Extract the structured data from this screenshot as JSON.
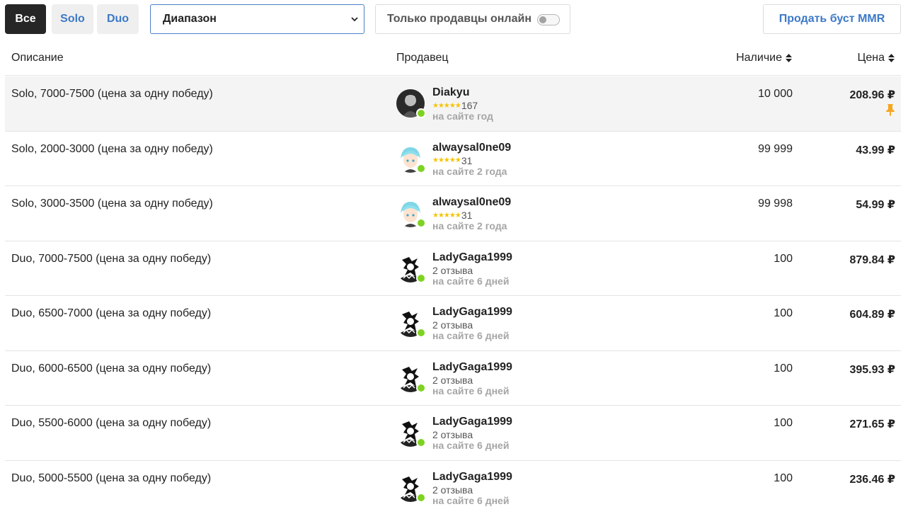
{
  "filters": {
    "all_label": "Все",
    "solo_label": "Solo",
    "duo_label": "Duo",
    "range_selected": "Диапазон",
    "online_only_label": "Только продавцы онлайн",
    "online_only_enabled": false,
    "sell_button_label": "Продать буст MMR"
  },
  "table": {
    "headers": {
      "description": "Описание",
      "seller": "Продавец",
      "stock": "Наличие",
      "price": "Цена"
    },
    "rows": [
      {
        "description": "Solo, 7000-7500 (цена за одну победу)",
        "seller": "Diakyu",
        "stars": "★★★★★",
        "rating": "167",
        "since": "на сайте год",
        "stock": "10 000",
        "price": "208.96 ₽",
        "pinned": true,
        "avatar": "dark-avatar"
      },
      {
        "description": "Solo, 2000-3000 (цена за одну победу)",
        "seller": "alwaysal0ne09",
        "stars": "★★★★★",
        "rating": "31",
        "since": "на сайте 2 года",
        "stock": "99 999",
        "price": "43.99 ₽",
        "pinned": false,
        "avatar": "anime-blue-hair-avatar"
      },
      {
        "description": "Solo, 3000-3500 (цена за одну победу)",
        "seller": "alwaysal0ne09",
        "stars": "★★★★★",
        "rating": "31",
        "since": "на сайте 2 года",
        "stock": "99 998",
        "price": "54.99 ₽",
        "pinned": false,
        "avatar": "anime-blue-hair-avatar"
      },
      {
        "description": "Duo, 7000-7500 (цена за одну победу)",
        "seller": "LadyGaga1999",
        "stars": "",
        "rating": "2 отзыва",
        "since": "на сайте 6 дней",
        "stock": "100",
        "price": "879.84 ₽",
        "pinned": false,
        "avatar": "manga-avatar"
      },
      {
        "description": "Duo, 6500-7000 (цена за одну победу)",
        "seller": "LadyGaga1999",
        "stars": "",
        "rating": "2 отзыва",
        "since": "на сайте 6 дней",
        "stock": "100",
        "price": "604.89 ₽",
        "pinned": false,
        "avatar": "manga-avatar"
      },
      {
        "description": "Duo, 6000-6500 (цена за одну победу)",
        "seller": "LadyGaga1999",
        "stars": "",
        "rating": "2 отзыва",
        "since": "на сайте 6 дней",
        "stock": "100",
        "price": "395.93 ₽",
        "pinned": false,
        "avatar": "manga-avatar"
      },
      {
        "description": "Duo, 5500-6000 (цена за одну победу)",
        "seller": "LadyGaga1999",
        "stars": "",
        "rating": "2 отзыва",
        "since": "на сайте 6 дней",
        "stock": "100",
        "price": "271.65 ₽",
        "pinned": false,
        "avatar": "manga-avatar"
      },
      {
        "description": "Duo, 5000-5500 (цена за одну победу)",
        "seller": "LadyGaga1999",
        "stars": "",
        "rating": "2 отзыва",
        "since": "на сайте 6 дней",
        "stock": "100",
        "price": "236.46 ₽",
        "pinned": false,
        "avatar": "manga-avatar"
      }
    ]
  },
  "colors": {
    "accent": "#3d79c8",
    "online": "#7ed321",
    "star": "#f5c400",
    "pin": "#f5a623"
  }
}
